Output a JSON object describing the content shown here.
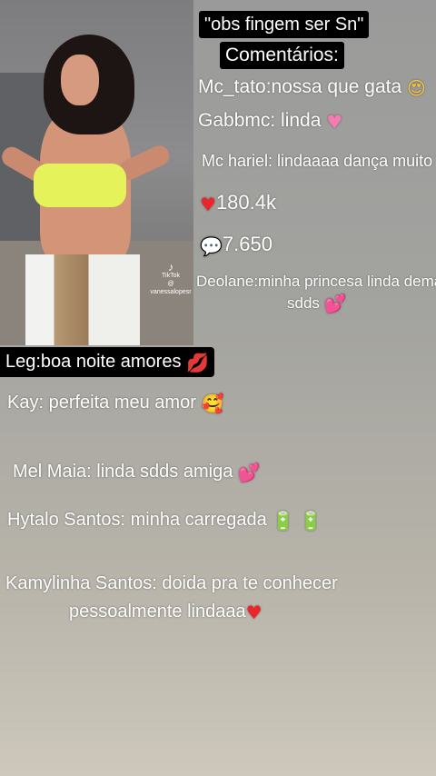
{
  "video": {
    "watermark_brand": "TikTok",
    "watermark_handle": "@ vanessalopesr"
  },
  "overlay": {
    "title_line1": "\"obs fingem ser Sn\"",
    "title_line2": "Comentários:",
    "caption": "Leg:boa noite amores"
  },
  "stats": {
    "likes": "180.4k",
    "comments_count": "7.650"
  },
  "comments": [
    {
      "text": "Mc_tato:nossa que gata",
      "emoji": "heart-eyes-emoji"
    },
    {
      "text": "Gabbmc: linda",
      "emoji": "pink-heart-emoji"
    },
    {
      "text": "Mc hariel: lindaaaa dança muito"
    },
    {
      "text": "Deolane:minha princesa linda demais",
      "text2": "sdds",
      "emoji": "two-hearts-emoji"
    },
    {
      "text": "Kay: perfeita meu amor",
      "emoji": "smiling-face-hearts-emoji"
    },
    {
      "text": "Mel Maia: linda sdds amiga",
      "emoji": "two-hearts-emoji"
    },
    {
      "text": "Hytalo Santos: minha carregada",
      "emoji": "battery-emoji"
    },
    {
      "text": "Kamylinha Santos: doida pra te conhecer",
      "text2": "pessoalmente lindaaa",
      "emoji": "red-heart-emoji"
    }
  ]
}
